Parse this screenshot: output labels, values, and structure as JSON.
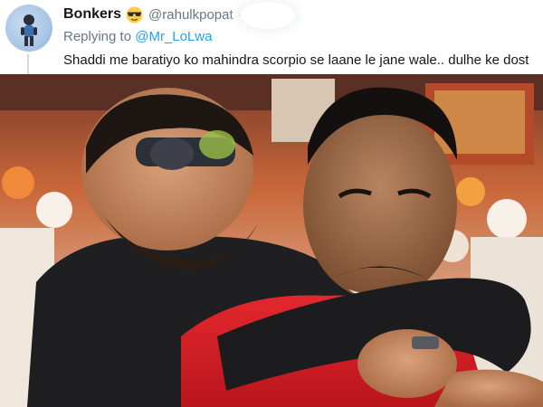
{
  "tweet": {
    "author": {
      "display_name": "Bonkers",
      "emoji": "sunglasses-emoji",
      "handle": "@rahulkpopat",
      "separator": "·",
      "avatar_icon": "avatar"
    },
    "reply": {
      "prefix": "Replying to",
      "to_handle": "@Mr_LoLwa"
    },
    "text": "Shaddi me baratiyo ko mahindra scorpio se laane le jane wale.. dulhe ke dost"
  },
  "colors": {
    "text_primary": "#14171a",
    "text_secondary": "#657786",
    "link": "#1da1f2"
  }
}
